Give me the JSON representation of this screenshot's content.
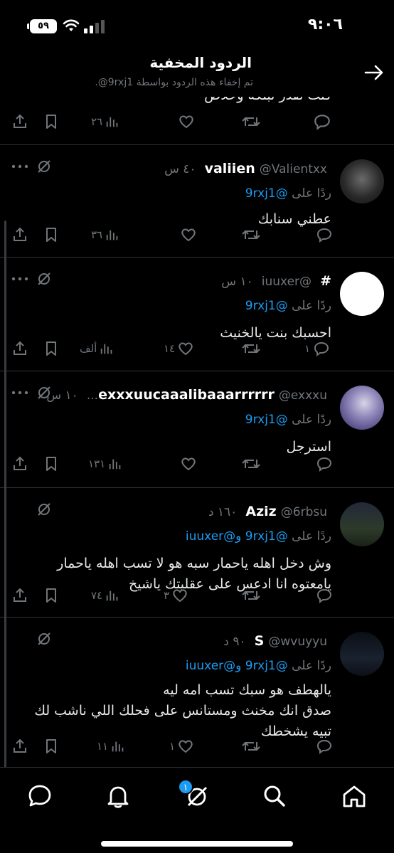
{
  "status_bar": {
    "time": "٩:٠٦",
    "battery": "٥٩"
  },
  "header": {
    "title": "الردود المخفية",
    "subtitle": "تم إخفاء هذه الردود بواسطة 9rxj1@."
  },
  "top_tweet": {
    "text": "كنت تقدر تبلكه وخلاص",
    "views": "٢٦"
  },
  "tweets": [
    {
      "name": "valiien",
      "handle": "@Valientxx",
      "time": "٤٠ س",
      "reply_prefix": "ردًا على",
      "mentions": "@9rxj1",
      "text": "عطني سنابك",
      "replies": "",
      "likes": "",
      "views": "٣٦"
    },
    {
      "name": "#",
      "handle": "@iuuxer",
      "time": "١٠ س",
      "reply_prefix": "ردًا على",
      "mentions": "@9rxj1",
      "text": "احسبك بنت يالخنيث",
      "replies": "١",
      "likes": "١٤",
      "views": "ألف"
    },
    {
      "name": "exxxuucaaalibaaarrrrrr",
      "handle": "@exxxu...",
      "time": "١٠ س",
      "reply_prefix": "ردًا على",
      "mentions": "@9rxj1",
      "text": "استرجل",
      "replies": "",
      "likes": "",
      "views": "١٣١"
    },
    {
      "name": "Aziz",
      "handle": "@6rbsu",
      "time": "١٦٠ د",
      "reply_prefix": "ردًا على",
      "mentions": "@9rxj1 و@iuuxer",
      "text": "وش دخل اهله ياحمار سبه هو لا تسب اهله ياحمار\nيامعتوه انا ادعس على عقليتك ياشيخ",
      "replies": "",
      "likes": "٣",
      "views": "٧٤"
    },
    {
      "name": "S",
      "handle": "@wvuyyu",
      "time": "٩٠ د",
      "reply_prefix": "ردًا على",
      "mentions": "@9rxj1 و@iuuxer",
      "text": "يالهطف هو سبك تسب امه ليه\nصدق انك مخنث ومستانس على فحلك اللي ناشب لك\nتبيه يشخطك",
      "replies": "",
      "likes": "١",
      "views": "١١"
    }
  ],
  "tabbar": {
    "badge": "١"
  },
  "colors": {
    "accent": "#1d9bf0",
    "muted": "#71767b",
    "divider": "#2f3336"
  }
}
